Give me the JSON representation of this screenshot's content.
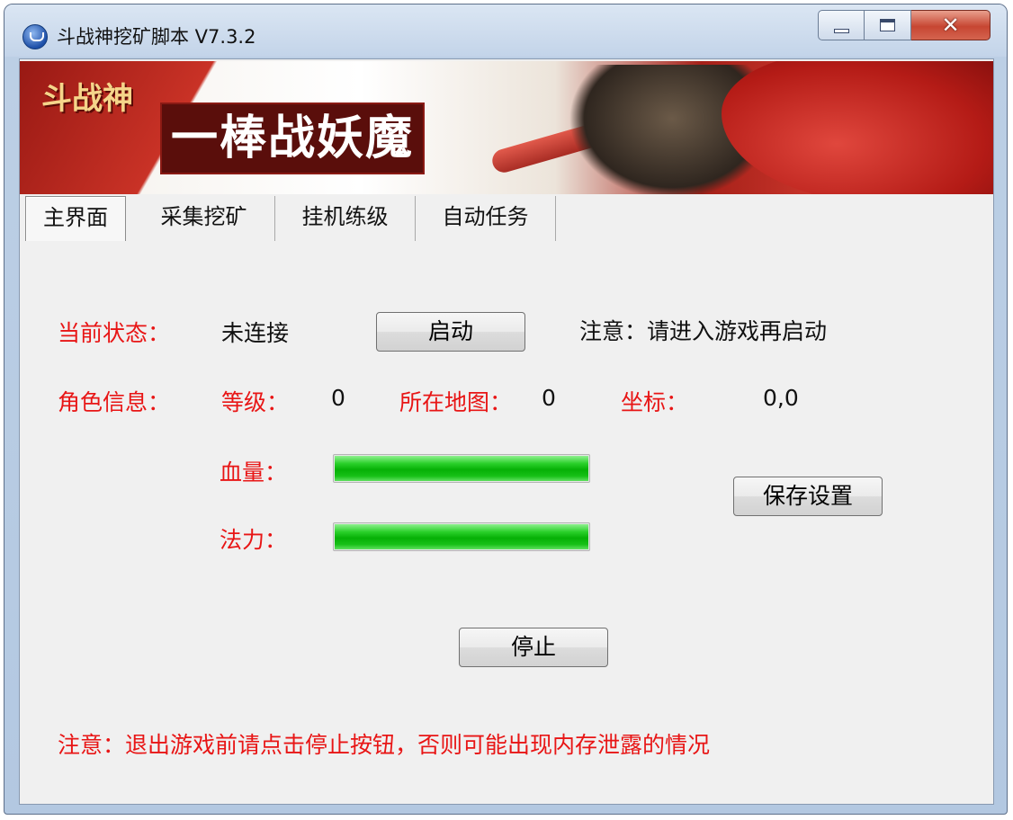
{
  "window": {
    "title": "斗战神挖矿脚本 V7.3.2",
    "icon": "app-globe-icon",
    "controls": {
      "minimize": "minimize-icon",
      "maximize": "maximize-icon",
      "close": "✕"
    }
  },
  "banner": {
    "logo_text": "斗战神",
    "slogan": "一棒战妖魔"
  },
  "tabs": [
    {
      "label": "主界面",
      "active": true
    },
    {
      "label": "采集挖矿",
      "active": false
    },
    {
      "label": "挂机练级",
      "active": false
    },
    {
      "label": "自动任务",
      "active": false
    }
  ],
  "status": {
    "label": "当前状态：",
    "value": "未连接",
    "start_button": "启动",
    "notice": "注意：请进入游戏再启动"
  },
  "character": {
    "label": "角色信息：",
    "level_label": "等级：",
    "level_value": "0",
    "map_label": "所在地图：",
    "map_value": "0",
    "coord_label": "坐标：",
    "coord_value": "0,0"
  },
  "hp": {
    "label": "血量：",
    "percent": 100
  },
  "mp": {
    "label": "法力：",
    "percent": 100
  },
  "buttons": {
    "save": "保存设置",
    "stop": "停止"
  },
  "footer_notice": "注意：退出游戏前请点击停止按钮，否则可能出现内存泄露的情况",
  "colors": {
    "warning_red": "#e81515",
    "progress_green": "#06b006",
    "close_red": "#c74632"
  }
}
